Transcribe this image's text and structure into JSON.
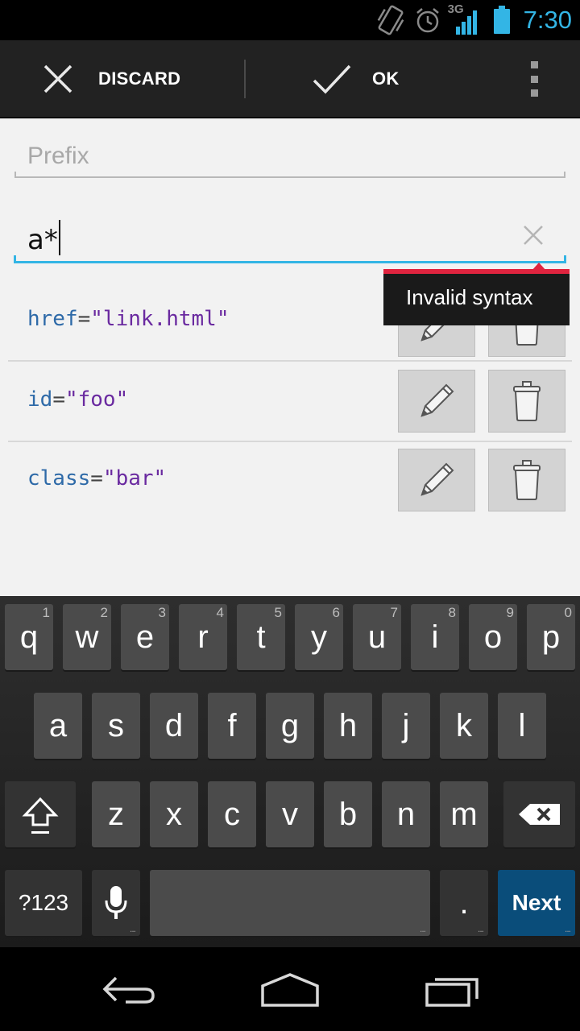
{
  "status_bar": {
    "network": "3G",
    "time": "7:30",
    "accent_color": "#33b5e5"
  },
  "action_bar": {
    "discard_label": "DISCARD",
    "ok_label": "OK",
    "discard_icon": "close-icon",
    "ok_icon": "check-icon",
    "overflow_icon": "overflow-menu-icon"
  },
  "form": {
    "prefix_placeholder": "Prefix",
    "value_text": "a*",
    "error_tooltip": "Invalid syntax",
    "error_color": "#e0243f"
  },
  "attributes": [
    {
      "name": "href",
      "eq": "=",
      "value": "\"link.html\""
    },
    {
      "name": "id",
      "eq": "=",
      "value": "\"foo\""
    },
    {
      "name": "class",
      "eq": "=",
      "value": "\"bar\""
    }
  ],
  "keyboard": {
    "row1": [
      {
        "ch": "q",
        "hint": "1"
      },
      {
        "ch": "w",
        "hint": "2"
      },
      {
        "ch": "e",
        "hint": "3"
      },
      {
        "ch": "r",
        "hint": "4"
      },
      {
        "ch": "t",
        "hint": "5"
      },
      {
        "ch": "y",
        "hint": "6"
      },
      {
        "ch": "u",
        "hint": "7"
      },
      {
        "ch": "i",
        "hint": "8"
      },
      {
        "ch": "o",
        "hint": "9"
      },
      {
        "ch": "p",
        "hint": "0"
      }
    ],
    "row2": [
      "a",
      "s",
      "d",
      "f",
      "g",
      "h",
      "j",
      "k",
      "l"
    ],
    "row3": [
      "z",
      "x",
      "c",
      "v",
      "b",
      "n",
      "m"
    ],
    "symbols_label": "?123",
    "period_label": ".",
    "next_label": "Next",
    "shift_icon": "shift-icon",
    "backspace_icon": "backspace-icon",
    "mic_icon": "microphone-icon"
  },
  "nav_bar": {
    "back_icon": "back-icon",
    "home_icon": "home-icon",
    "recents_icon": "recent-apps-icon"
  }
}
